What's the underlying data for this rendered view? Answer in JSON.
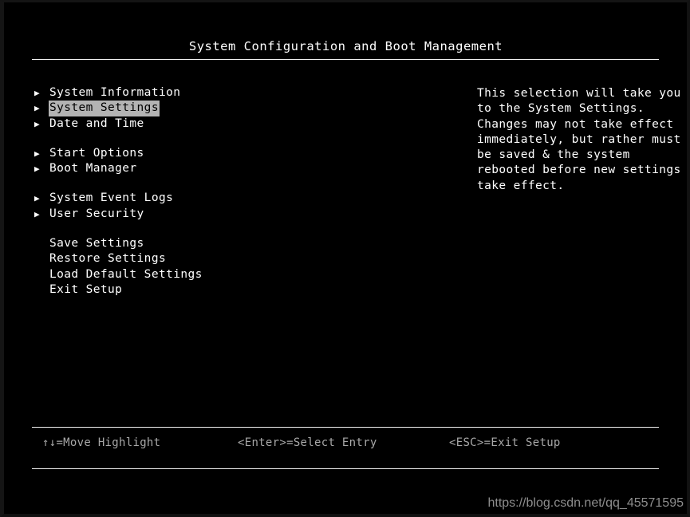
{
  "screen": {
    "title": "System Configuration and Boot Management",
    "background_color": "#000000",
    "text_color": "#ffffff",
    "highlight_bg_color": "#b3b3b3",
    "highlight_text_color": "#000000",
    "hint_color": "#a8a8a8",
    "rule_color": "#f2f2f2"
  },
  "menu": {
    "groups": [
      {
        "items": [
          {
            "label": "System Information",
            "bullet": "▶",
            "selected": false
          },
          {
            "label": "System Settings",
            "bullet": "▶",
            "selected": true
          },
          {
            "label": "Date and Time",
            "bullet": "▶",
            "selected": false
          }
        ]
      },
      {
        "items": [
          {
            "label": "Start Options",
            "bullet": "▶",
            "selected": false
          },
          {
            "label": "Boot Manager",
            "bullet": "▶",
            "selected": false
          }
        ]
      },
      {
        "items": [
          {
            "label": "System Event Logs",
            "bullet": "▶",
            "selected": false
          },
          {
            "label": "User Security",
            "bullet": "▶",
            "selected": false
          }
        ]
      },
      {
        "items": [
          {
            "label": "Save Settings",
            "bullet": "",
            "selected": false
          },
          {
            "label": "Restore Settings",
            "bullet": "",
            "selected": false
          },
          {
            "label": "Load Default Settings",
            "bullet": "",
            "selected": false
          },
          {
            "label": "Exit Setup",
            "bullet": "",
            "selected": false
          }
        ]
      }
    ]
  },
  "help": {
    "lines": [
      "This selection will take you",
      "to the System Settings.",
      "Changes may not take effect",
      "immediately, but rather must",
      "be saved & the system",
      "rebooted before new settings",
      "take effect."
    ]
  },
  "footer": {
    "hints": [
      "↑↓=Move Highlight",
      "<Enter>=Select Entry",
      "<ESC>=Exit Setup"
    ]
  },
  "watermark": {
    "text": "https://blog.csdn.net/qq_45571595"
  }
}
